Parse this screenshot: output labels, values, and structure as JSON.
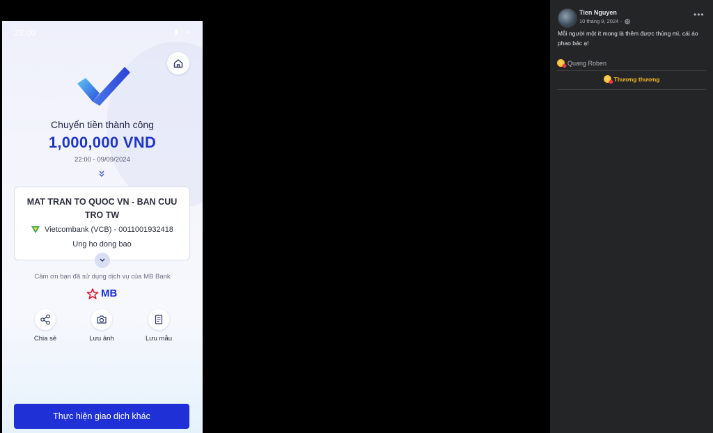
{
  "phone": {
    "status_time": "22:00",
    "title": "Chuyển tiền thành công",
    "amount": "1,000,000 VND",
    "datetime": "22:00 - 09/09/2024",
    "beneficiary": "MAT TRAN TO QUOC VN - BAN CUU TRO TW",
    "bank": "Vietcombank (VCB) - 0011001932418",
    "note": "Ung ho dong bao",
    "thanks": "Cảm ơn bạn đã sử dụng dịch vụ của MB Bank",
    "brand": "MB",
    "actions": [
      {
        "label": "Chia sẻ",
        "icon": "share-icon"
      },
      {
        "label": "Lưu ảnh",
        "icon": "camera-icon"
      },
      {
        "label": "Lưu mẫu",
        "icon": "template-icon"
      }
    ],
    "cta_label": "Thực hiện giao dịch khác",
    "colors": {
      "accent": "#1f30d6",
      "amount": "#1f35c9"
    }
  },
  "post": {
    "author": "Tien Nguyen",
    "date": "10 tháng 9, 2024",
    "text": "Mỗi người một ít mong là thêm được thùng mì, cái áo phao bác ạ!",
    "reactor": "Quang Roben",
    "reaction_label": "Thương thương",
    "colors": {
      "background": "#242526",
      "reaction": "#f7b928"
    }
  }
}
